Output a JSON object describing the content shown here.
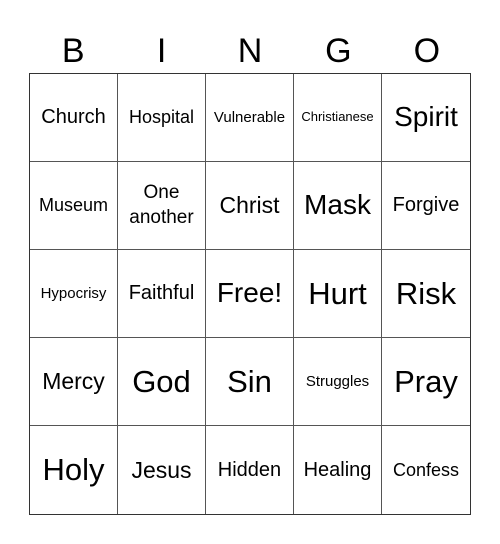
{
  "header": {
    "letters": [
      "B",
      "I",
      "N",
      "G",
      "O"
    ]
  },
  "board": {
    "rows": [
      [
        "Church",
        "Hospital",
        "Vulnerable",
        "Christianese",
        "Spirit"
      ],
      [
        "Museum",
        "One another",
        "Christ",
        "Mask",
        "Forgive"
      ],
      [
        "Hypocrisy",
        "Faithful",
        "Free!",
        "Hurt",
        "Risk"
      ],
      [
        "Mercy",
        "God",
        "Sin",
        "Struggles",
        "Pray"
      ],
      [
        "Holy",
        "Jesus",
        "Hidden",
        "Healing",
        "Confess"
      ]
    ]
  }
}
